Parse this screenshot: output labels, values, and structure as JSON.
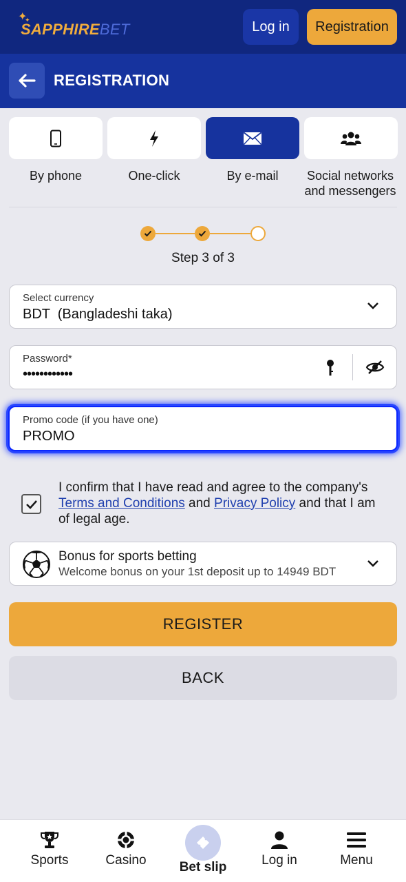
{
  "header": {
    "logo_text_main": "SAPPHIRE",
    "logo_text_accent": "BET",
    "login_label": "Log in",
    "register_label": "Registration"
  },
  "titlebar": {
    "title": "REGISTRATION"
  },
  "methods": [
    {
      "label": "By phone",
      "icon": "phone-icon",
      "active": false
    },
    {
      "label": "One-click",
      "icon": "lightning-icon",
      "active": false
    },
    {
      "label": "By e-mail",
      "icon": "envelope-icon",
      "active": true
    },
    {
      "label": "Social networks and messengers",
      "icon": "users-icon",
      "active": false
    }
  ],
  "steps": {
    "text": "Step 3 of 3",
    "completed": 2,
    "total": 3
  },
  "form": {
    "currency": {
      "label": "Select currency",
      "value": "BDT  (Bangladeshi taka)"
    },
    "password": {
      "label": "Password*",
      "value": "••••••••••••"
    },
    "promo": {
      "label": "Promo code (if you have one)",
      "value": "PROMO"
    }
  },
  "terms": {
    "prefix": "I confirm that I have read and agree to the company's ",
    "terms_link": "Terms and Conditions",
    "and": " and ",
    "privacy_link": "Privacy Policy",
    "suffix": " and that I am of legal age.",
    "checked": true
  },
  "bonus": {
    "title": "Bonus for sports betting",
    "subtitle": "Welcome bonus on your 1st deposit up to 14949 BDT"
  },
  "buttons": {
    "register": "REGISTER",
    "back": "BACK"
  },
  "bottom_nav": [
    {
      "label": "Sports",
      "icon": "trophy-icon"
    },
    {
      "label": "Casino",
      "icon": "chip-icon"
    },
    {
      "label": "Bet slip",
      "icon": "ticket-icon"
    },
    {
      "label": "Log in",
      "icon": "user-icon"
    },
    {
      "label": "Menu",
      "icon": "hamburger-icon"
    }
  ],
  "colors": {
    "navy": "#10277f",
    "blue": "#16339e",
    "accent": "#eda83b"
  }
}
